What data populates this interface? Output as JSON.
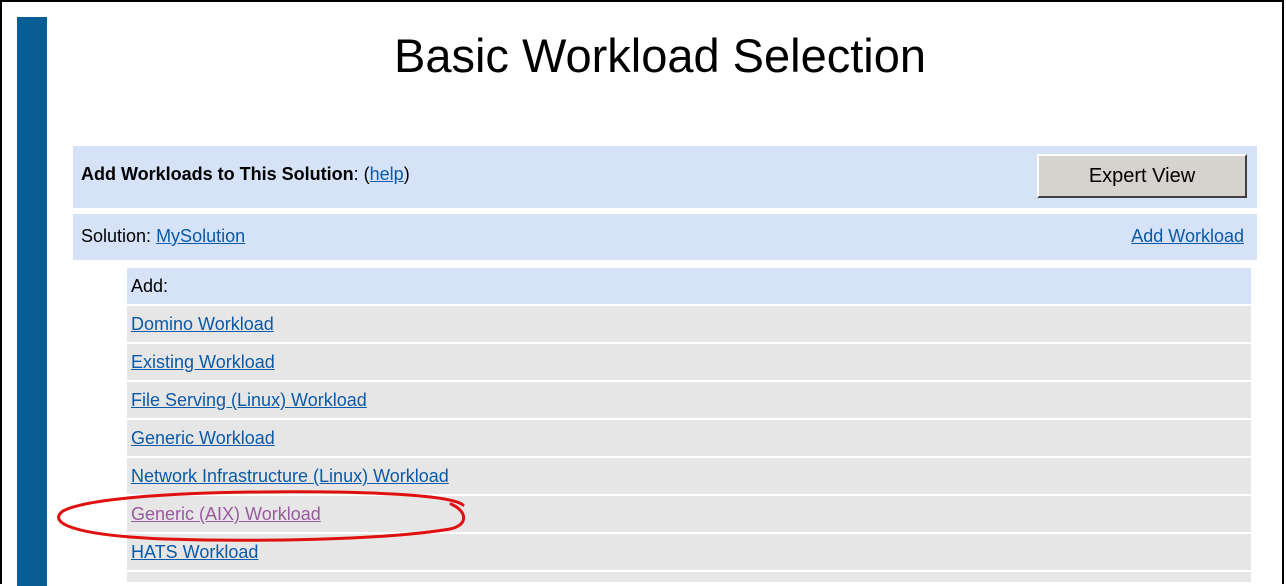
{
  "page": {
    "title": "Basic Workload Selection"
  },
  "header": {
    "label": "Add Workloads to This Solution",
    "colon": ": (",
    "help_link": "help",
    "close_paren": ")",
    "expert_button": "Expert View"
  },
  "solution": {
    "prefix": "Solution: ",
    "name_link": "MySolution",
    "add_workload_link": "Add Workload"
  },
  "list": {
    "header": "Add:",
    "items": [
      {
        "label": "Domino Workload"
      },
      {
        "label": "Existing Workload"
      },
      {
        "label": "File Serving (Linux) Workload"
      },
      {
        "label": "Generic Workload"
      },
      {
        "label": "Network Infrastructure (Linux) Workload"
      },
      {
        "label": "Generic (AIX) Workload",
        "visited": true
      },
      {
        "label": "HATS Workload"
      }
    ]
  },
  "colors": {
    "accent_bar": "#0a5e96",
    "band": "#d5e2f7",
    "row": "#e6e6e6",
    "link": "#0b5aa8",
    "visited_link": "#9a5aa0",
    "highlight": "#e01010"
  }
}
